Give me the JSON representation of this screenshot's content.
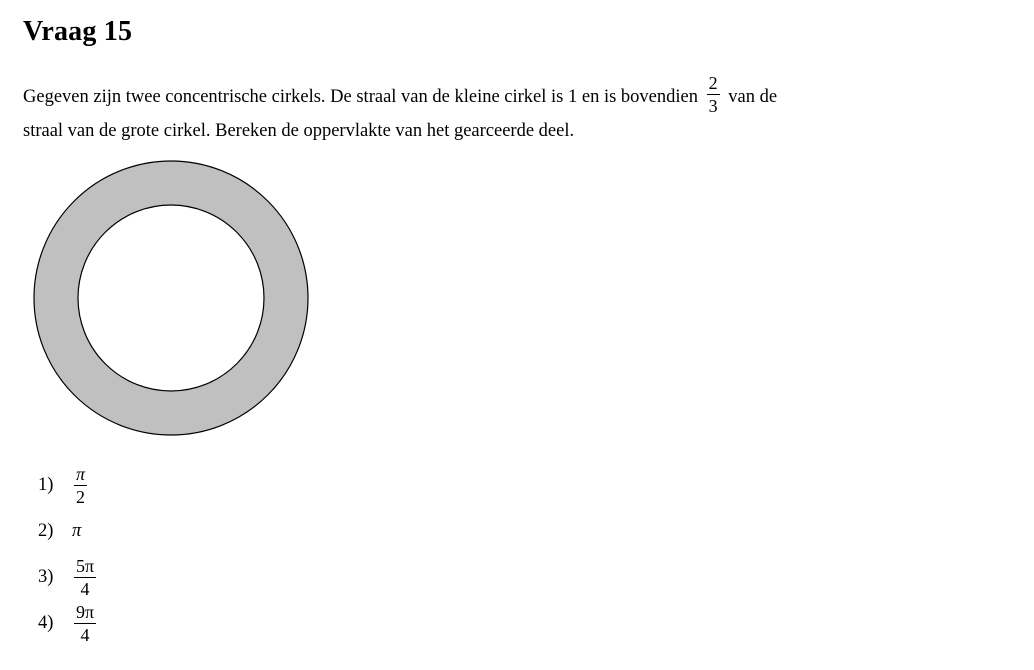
{
  "question": {
    "title": "Vraag 15",
    "text_line1_before": "Gegeven zijn twee concentrische cirkels. De straal van de kleine cirkel is 1 en is bovendien",
    "fraction_numerator": "2",
    "fraction_denominator": "3",
    "text_line1_after": "van de",
    "text_line2": "straal van de grote cirkel. Bereken de oppervlakte van het gearceerde deel."
  },
  "figure": {
    "ring_fill": "#c0c0c0",
    "inner_fill": "#ffffff",
    "stroke": "#000000"
  },
  "options": [
    {
      "label": "1)",
      "numerator": "π",
      "denominator": "2"
    },
    {
      "label": "2)",
      "value": "π"
    },
    {
      "label": "3)",
      "numerator": "5π",
      "denominator": "4"
    },
    {
      "label": "4)",
      "numerator": "9π",
      "denominator": "4"
    }
  ]
}
